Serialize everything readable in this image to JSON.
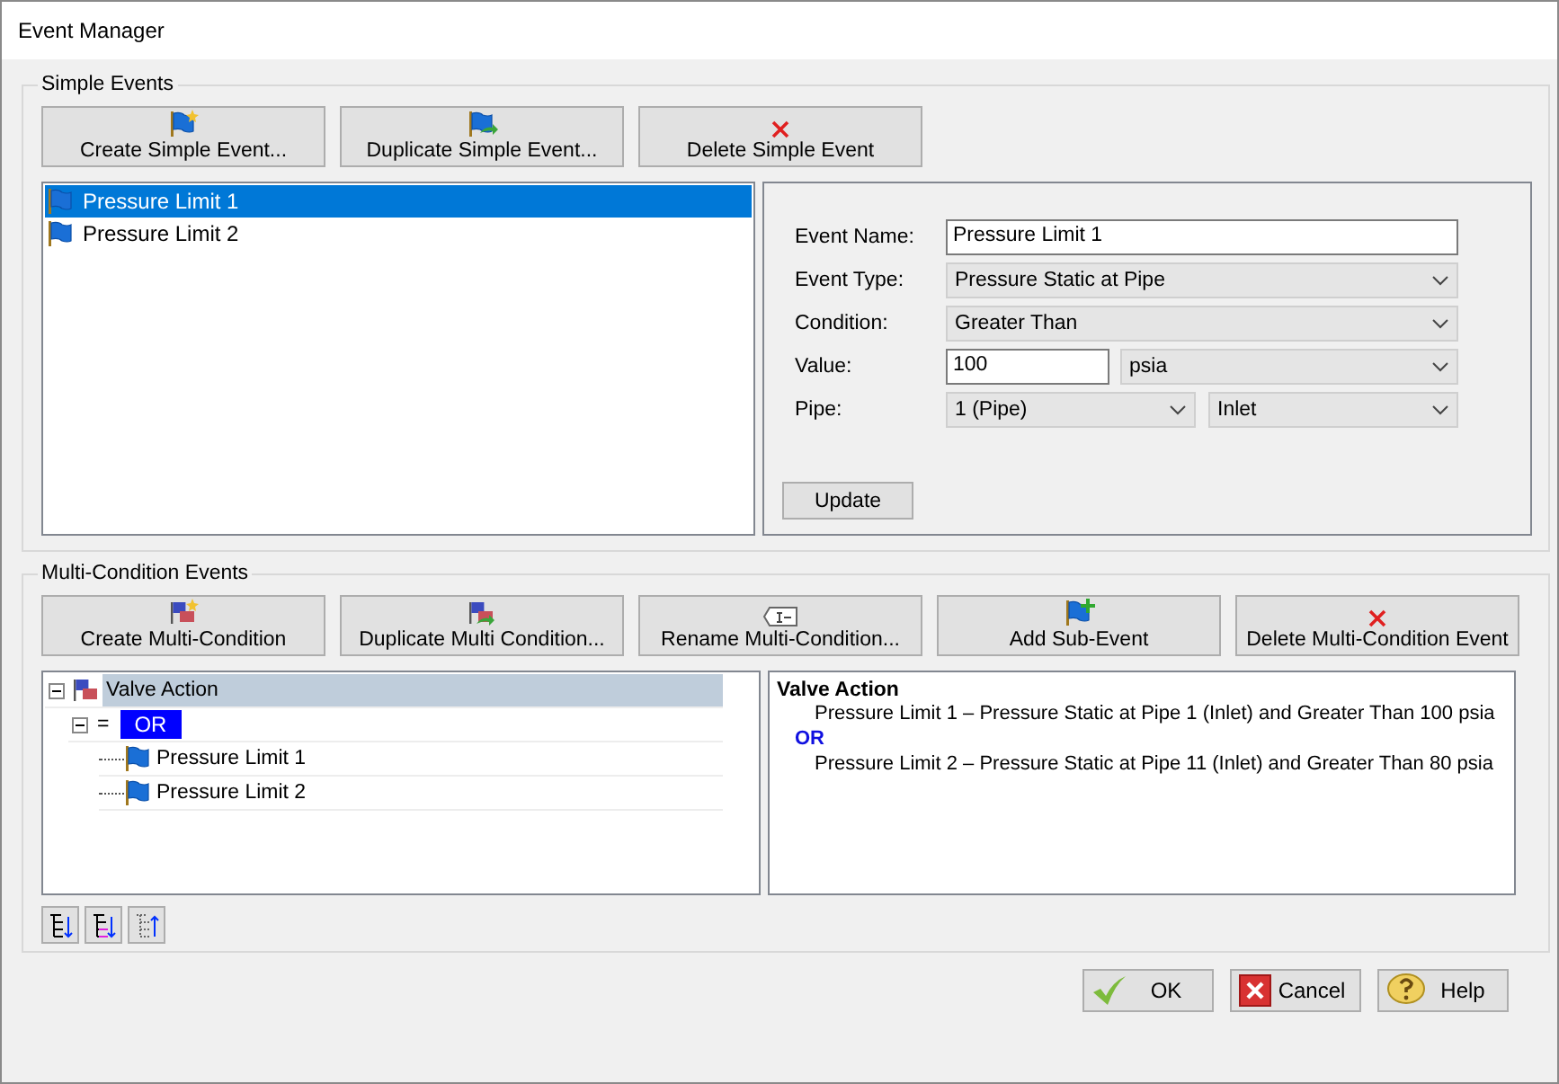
{
  "window": {
    "title": "Event Manager"
  },
  "simple_events": {
    "title": "Simple Events",
    "buttons": [
      "Create Simple Event...",
      "Duplicate Simple Event...",
      "Delete Simple Event"
    ],
    "list": [
      {
        "label": "Pressure Limit 1",
        "selected": true
      },
      {
        "label": "Pressure Limit 2",
        "selected": false
      }
    ],
    "form": {
      "event_name_label": "Event Name:",
      "event_name": "Pressure Limit 1",
      "event_type_label": "Event Type:",
      "event_type": "Pressure Static at Pipe",
      "condition_label": "Condition:",
      "condition": "Greater Than",
      "value_label": "Value:",
      "value": "100",
      "unit": "psia",
      "pipe_label": "Pipe:",
      "pipe": "1 (Pipe)",
      "pipe_end": "Inlet"
    },
    "update_button": "Update"
  },
  "multi_condition_events": {
    "title": "Multi-Condition Events",
    "buttons": [
      "Create Multi-Condition",
      "Duplicate Multi Condition...",
      "Rename Multi-Condition...",
      "Add Sub-Event",
      "Delete Multi-Condition Event"
    ],
    "tree": [
      {
        "kind": "group",
        "label": "Valve Action",
        "selected": true,
        "expanded": true,
        "children": [
          {
            "kind": "operator",
            "prefix": "=",
            "label": "OR",
            "expanded": true,
            "children": [
              {
                "kind": "event",
                "label": "Pressure Limit 1"
              },
              {
                "kind": "event",
                "label": "Pressure Limit 2"
              }
            ]
          }
        ]
      }
    ],
    "description": {
      "title": "Valve Action",
      "lines": [
        {
          "kind": "condition",
          "text": "Pressure Limit 1 – Pressure Static at Pipe 1 (Inlet) and Greater Than 100 psia"
        },
        {
          "kind": "operator",
          "text": "OR"
        },
        {
          "kind": "condition",
          "text": "Pressure Limit 2 – Pressure Static at Pipe 11 (Inlet) and Greater Than 80 psia"
        }
      ]
    }
  },
  "footer_buttons": [
    "OK",
    "Cancel",
    "Help"
  ]
}
